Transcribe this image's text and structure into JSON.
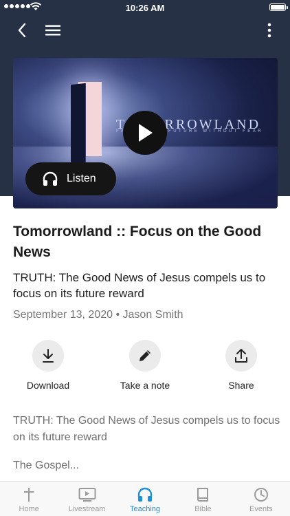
{
  "status_bar": {
    "time": "10:26 AM"
  },
  "media": {
    "art_title": "TOMORROWLAND",
    "art_subtitle": "FACING THE FUTURE WITHOUT FEAR",
    "listen_label": "Listen"
  },
  "sermon": {
    "title": "Tomorrowland :: Focus on the Good News",
    "summary": "TRUTH: The Good News of Jesus compels us to focus on its future reward",
    "date": "September 13, 2020",
    "separator": "•",
    "speaker": "Jason Smith"
  },
  "actions": [
    {
      "label": "Download",
      "icon": "download-icon"
    },
    {
      "label": "Take a note",
      "icon": "pencil-icon"
    },
    {
      "label": "Share",
      "icon": "share-icon"
    }
  ],
  "description": {
    "line": "TRUTH: The Good News of Jesus compels us to focus on its future reward",
    "gospel": "The Gospel..."
  },
  "tabs": [
    {
      "label": "Home",
      "icon": "cross-icon"
    },
    {
      "label": "Livestream",
      "icon": "tv-icon"
    },
    {
      "label": "Teaching",
      "icon": "headphones-icon"
    },
    {
      "label": "Bible",
      "icon": "book-icon"
    },
    {
      "label": "Events",
      "icon": "clock-icon"
    }
  ],
  "colors": {
    "header_bg": "#263145",
    "accent": "#1e8fd8"
  }
}
